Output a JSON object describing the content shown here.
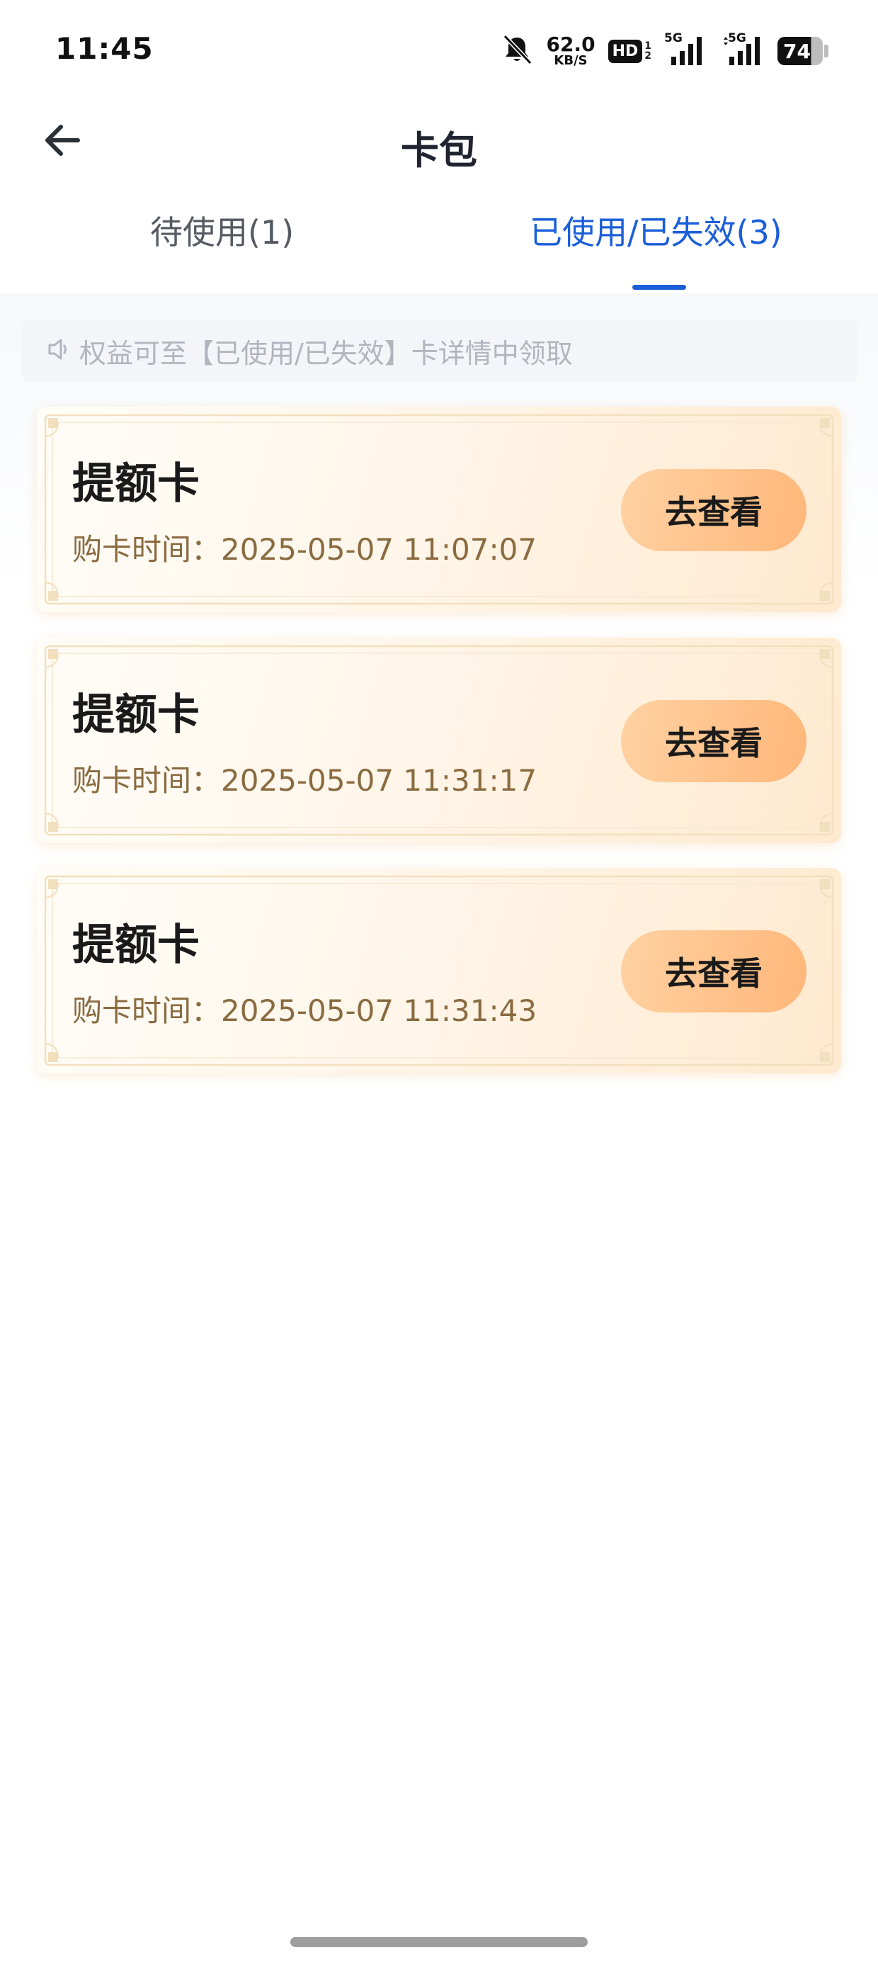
{
  "status_bar": {
    "time": "11:45",
    "net_speed_value": "62.0",
    "net_speed_unit": "KB/S",
    "hd_label": "HD",
    "hd_sub_top": "1",
    "hd_sub_bottom": "2",
    "signal_1_label": "5G",
    "signal_2_label": "5G",
    "battery_level": "74",
    "icons": [
      "bell-muted-icon",
      "signal-icon",
      "battery-icon"
    ]
  },
  "nav": {
    "title": "卡包",
    "back_icon": "arrow-left-icon"
  },
  "tabs": [
    {
      "label": "待使用(1)",
      "active": false
    },
    {
      "label": "已使用/已失效(3)",
      "active": true
    }
  ],
  "notice": {
    "icon": "speaker-icon",
    "text": "权益可至【已使用/已失效】卡详情中领取"
  },
  "cards": [
    {
      "title": "提额卡",
      "purchase_time": "购卡时间：2025-05-07 11:07:07",
      "button_label": "去查看"
    },
    {
      "title": "提额卡",
      "purchase_time": "购卡时间：2025-05-07 11:31:17",
      "button_label": "去查看"
    },
    {
      "title": "提额卡",
      "purchase_time": "购卡时间：2025-05-07 11:31:43",
      "button_label": "去查看"
    }
  ],
  "colors": {
    "accent": "#1b5fd8",
    "button_gradient_start": "#ffd1a3",
    "button_gradient_end": "#ffb779",
    "card_time_text": "#8a6b40"
  }
}
